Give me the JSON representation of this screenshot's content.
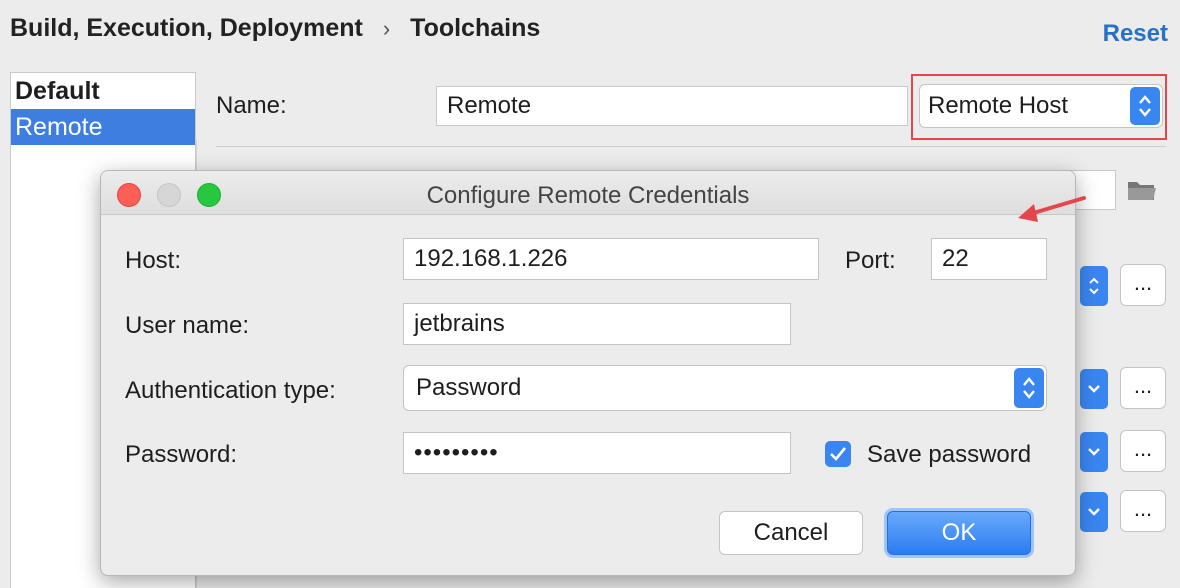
{
  "breadcrumb": {
    "parent": "Build, Execution, Deployment",
    "separator": "›",
    "current": "Toolchains"
  },
  "reset_label": "Reset",
  "toolchains": {
    "items": [
      {
        "label": "Default"
      },
      {
        "label": "Remote"
      }
    ]
  },
  "form": {
    "name_label": "Name:",
    "name_value": "Remote",
    "type_value": "Remote Host"
  },
  "bg_buttons": {
    "dots": "..."
  },
  "dialog": {
    "title": "Configure Remote Credentials",
    "host_label": "Host:",
    "host_value": "192.168.1.226",
    "port_label": "Port:",
    "port_value": "22",
    "user_label": "User name:",
    "user_value": "jetbrains",
    "auth_label": "Authentication type:",
    "auth_value": "Password",
    "password_label": "Password:",
    "password_value": "•••••••••",
    "save_password_label": "Save password",
    "save_password_checked": true,
    "cancel_label": "Cancel",
    "ok_label": "OK"
  },
  "colors": {
    "accent": "#3a86f0",
    "highlight": "#e2474c",
    "selection": "#3d7ee0",
    "link": "#2672c8"
  }
}
